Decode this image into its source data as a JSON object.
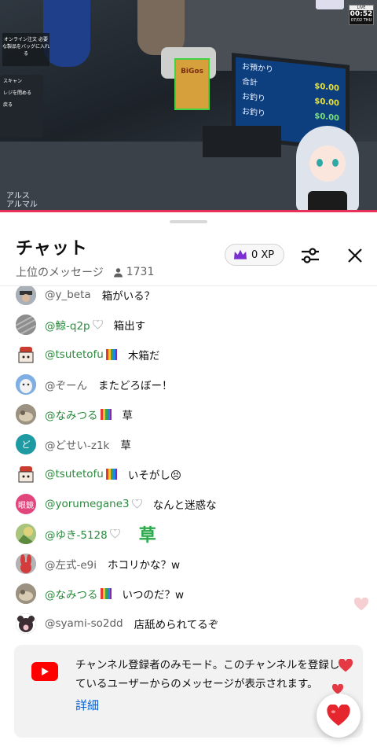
{
  "video": {
    "order_panel": "オンライン注文\n必要な製品をバッグに入れる",
    "left_menu": [
      "スキャン",
      "レジを閉める",
      "戻る"
    ],
    "screen": {
      "rows": [
        {
          "label": "お預かり",
          "value": ""
        },
        {
          "label": "合計",
          "value": "$0.00"
        },
        {
          "label": "お釣り",
          "value": "$0.00"
        },
        {
          "label": "お釣り",
          "value": "$0.00"
        }
      ]
    },
    "box_label": "BiGos",
    "timer": {
      "live": "LIVE",
      "time": "00:52",
      "date": "07/02 THU"
    },
    "logo": "アルス\nアルマル"
  },
  "chat": {
    "title": "チャット",
    "subtitle": "上位のメッセージ",
    "viewer_count": "1731",
    "xp_label": "0 XP",
    "accent": "#8a2be2"
  },
  "messages": [
    {
      "author": "@y_beta",
      "text": "箱がいる？",
      "member": false,
      "avatar": "#7a7a7a",
      "avatar_text": ""
    },
    {
      "author": "@鯨-q2p",
      "text": "箱出す",
      "member": true,
      "avatar": "#9a9a9a",
      "avatar_text": ""
    },
    {
      "author": "@tsutetofu",
      "text": "木箱だ",
      "member": true,
      "avatar": "#c93c2e",
      "avatar_text": ""
    },
    {
      "author": "@ぞーん",
      "text": "またどろぼー！",
      "member": false,
      "avatar": "#6d9ad6",
      "avatar_text": ""
    },
    {
      "author": "@なみつる",
      "text": "草",
      "member": true,
      "avatar": "#8a8072",
      "avatar_text": ""
    },
    {
      "author": "@どせい-z1k",
      "text": "草",
      "member": false,
      "avatar": "#1e9aa3",
      "avatar_text": "ど"
    },
    {
      "author": "@tsutetofu",
      "text": "いそがし😣",
      "member": true,
      "avatar": "#c93c2e",
      "avatar_text": ""
    },
    {
      "author": "@yorumegane3",
      "text": "なんと迷惑な",
      "member": true,
      "avatar": "#e0457b",
      "avatar_text": "眼鏡"
    },
    {
      "author": "@ゆき-5128",
      "text": "草",
      "member": true,
      "avatar": "#8fae66",
      "avatar_text": ""
    },
    {
      "author": "@左式-e9i",
      "text": "ホコリかな？w",
      "member": false,
      "avatar": "#d43c3c",
      "avatar_text": ""
    },
    {
      "author": "@なみつる",
      "text": "いつのだ？w",
      "member": true,
      "avatar": "#8a8072",
      "avatar_text": ""
    },
    {
      "author": "@syami-so2dd",
      "text": "店舐められてるぞ",
      "member": false,
      "avatar": "#2d2d2d",
      "avatar_text": ""
    }
  ],
  "notice": {
    "text": "チャンネル登録者のみモード。このチャンネルを登録しているユーザーからのメッセージが表示されます。",
    "link": "詳細"
  }
}
